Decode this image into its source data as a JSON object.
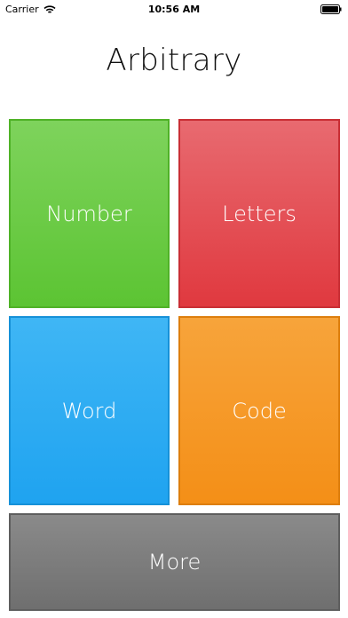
{
  "status_bar": {
    "carrier": "Carrier",
    "time": "10:56 AM",
    "wifi_icon": "wifi-icon",
    "battery_icon": "battery-icon"
  },
  "app": {
    "title": "Arbitrary"
  },
  "tiles": [
    {
      "label": "Number",
      "color": "#5cc433"
    },
    {
      "label": "Letters",
      "color": "#e0393f"
    },
    {
      "label": "Word",
      "color": "#1fa3f0"
    },
    {
      "label": "Code",
      "color": "#f48f17"
    },
    {
      "label": "More",
      "color": "#777777"
    }
  ]
}
